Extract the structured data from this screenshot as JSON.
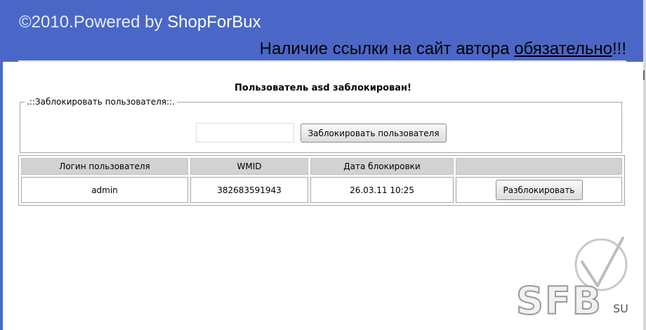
{
  "header": {
    "copyright_prefix": "©2010.Powered by ",
    "brand": "ShopForBux",
    "note_text": "Наличие ссылки на сайт автора ",
    "note_link": "обязательно",
    "note_suffix": "!!!"
  },
  "message": "Пользователь asd заблокирован!",
  "block_form": {
    "legend": ".::Заблокировать пользователя::.",
    "input_value": "",
    "submit_label": "Заблокировать пользователя"
  },
  "table": {
    "headers": [
      "Логин пользователя",
      "WMID",
      "Дата блокировки",
      ""
    ],
    "rows": [
      {
        "login": "admin",
        "wmid": "382683591943",
        "date": "26.03.11 10:25",
        "action_label": "Разблокировать"
      }
    ]
  },
  "watermark": {
    "letters": "SFB",
    "suffix": "SU"
  },
  "colors": {
    "header_bg": "#4a67c8",
    "table_header_bg": "#d2d2d2"
  }
}
